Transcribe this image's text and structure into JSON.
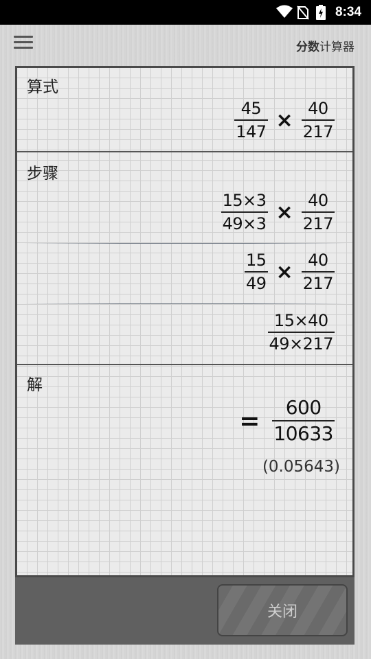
{
  "status_bar": {
    "time": "8:34"
  },
  "app_bar": {
    "title_bold": "分数",
    "title_rest": "计算器"
  },
  "expression": {
    "label": "算式",
    "left": {
      "num": "45",
      "den": "147"
    },
    "operator": "×",
    "right": {
      "num": "40",
      "den": "217"
    }
  },
  "steps": {
    "label": "步骤",
    "items": [
      {
        "left": {
          "num": "15×3",
          "den": "49×3"
        },
        "operator": "×",
        "right": {
          "num": "40",
          "den": "217"
        }
      },
      {
        "left": {
          "num": "15",
          "den": "49"
        },
        "operator": "×",
        "right": {
          "num": "40",
          "den": "217"
        }
      },
      {
        "single": {
          "num": "15×40",
          "den": "49×217"
        }
      }
    ]
  },
  "solution": {
    "label": "解",
    "equals": "=",
    "result": {
      "num": "600",
      "den": "10633"
    },
    "decimal": "(0.05643)"
  },
  "footer": {
    "close_label": "关闭"
  }
}
